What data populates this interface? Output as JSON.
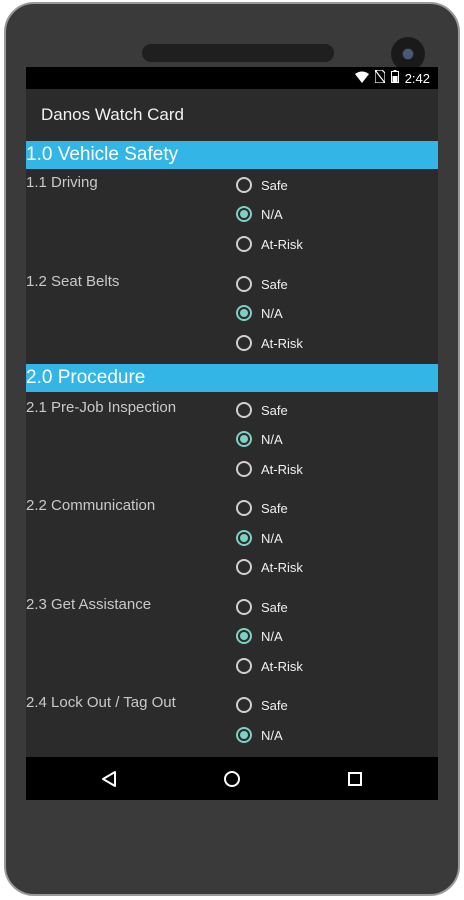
{
  "status_bar": {
    "time": "2:42",
    "icons": [
      "wifi-icon",
      "no-sim-icon",
      "battery-icon"
    ]
  },
  "app": {
    "title": "Danos Watch Card"
  },
  "options": [
    "Safe",
    "N/A",
    "At-Risk"
  ],
  "sections": [
    {
      "title": "1.0 Vehicle Safety",
      "items": [
        {
          "label": "1.1 Driving",
          "selected": "N/A"
        },
        {
          "label": "1.2 Seat Belts",
          "selected": "N/A"
        }
      ]
    },
    {
      "title": "2.0 Procedure",
      "items": [
        {
          "label": "2.1 Pre-Job Inspection",
          "selected": "N/A"
        },
        {
          "label": "2.2 Communication",
          "selected": "N/A"
        },
        {
          "label": "2.3 Get Assistance",
          "selected": "N/A"
        },
        {
          "label": "2.4 Lock Out / Tag Out",
          "selected": "N/A"
        }
      ]
    }
  ],
  "nav": [
    "back-icon",
    "home-icon",
    "recents-icon"
  ],
  "colors": {
    "accent": "#33b5e5",
    "radio_checked": "#7fd0c4",
    "background": "#2b2b2b"
  }
}
